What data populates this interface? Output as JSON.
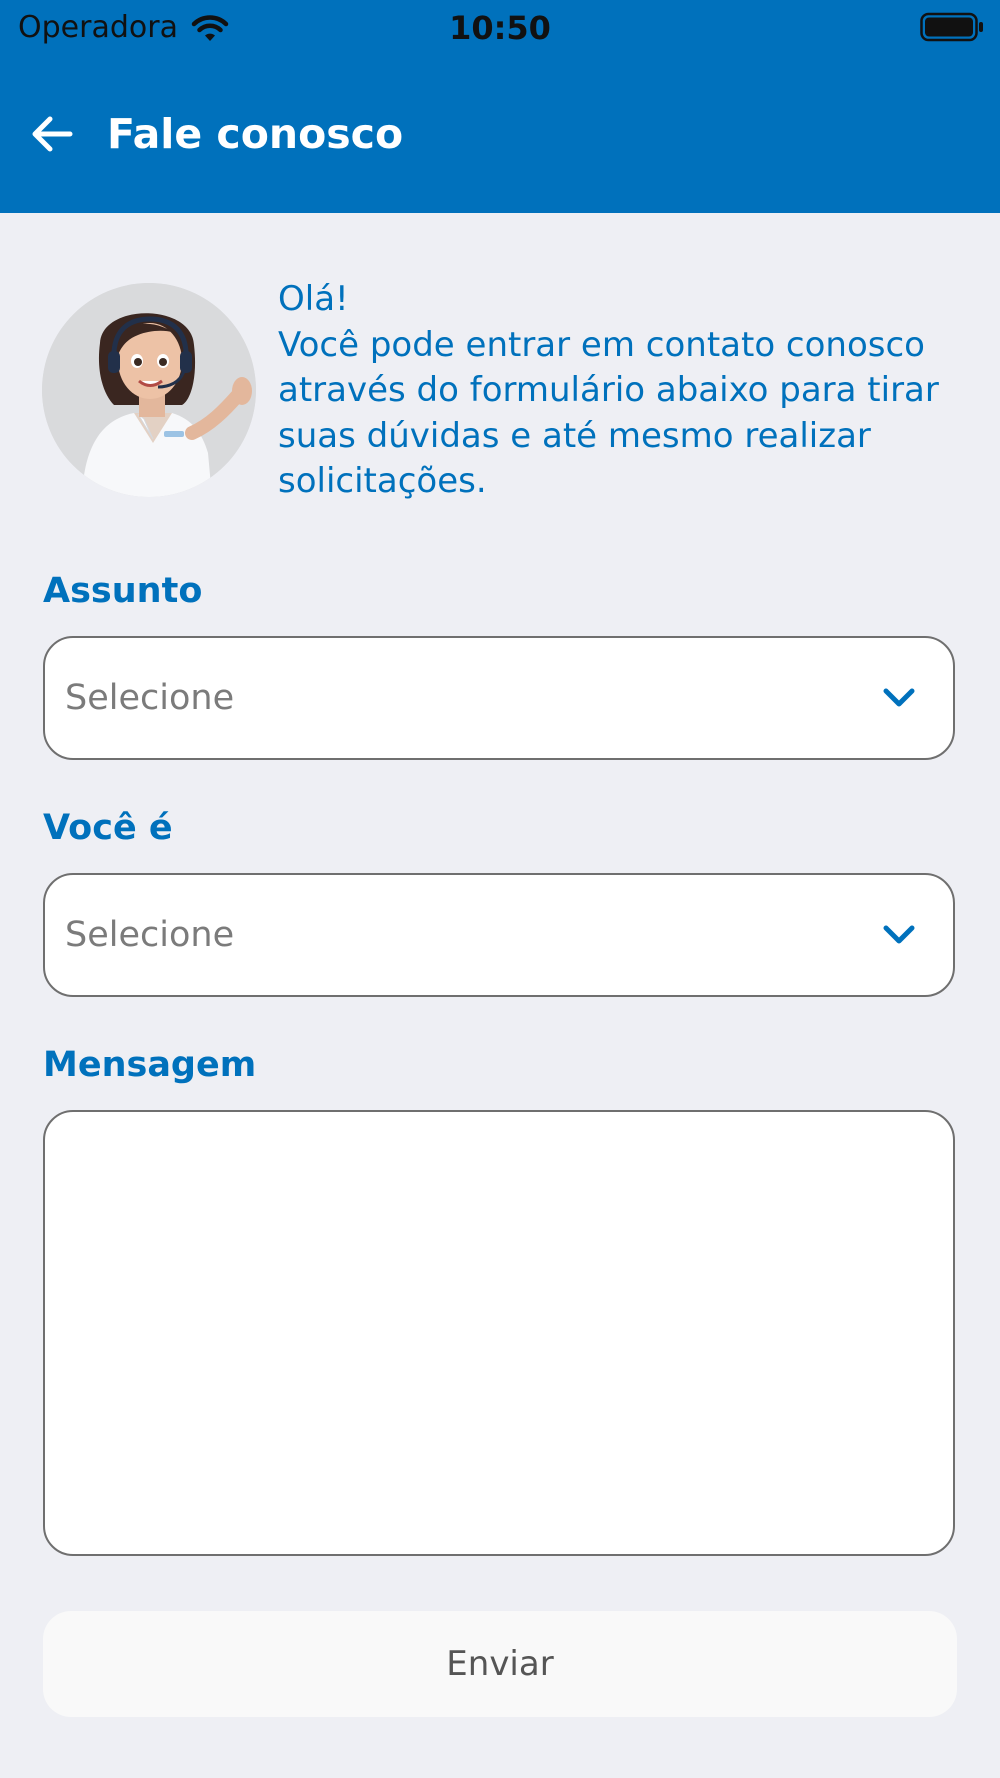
{
  "status_bar": {
    "carrier": "Operadora",
    "time": "10:50"
  },
  "header": {
    "title": "Fale conosco",
    "background": "#0071bc"
  },
  "intro": {
    "lines": [
      "Olá!",
      "Você pode entrar em contato conosco",
      "através do formulário abaixo para tirar",
      "suas dúvidas e até mesmo realizar",
      "solicitações."
    ]
  },
  "form": {
    "assunto": {
      "label": "Assunto",
      "value": "Selecione"
    },
    "voce_e": {
      "label": "Você é",
      "value": "Selecione"
    },
    "mensagem": {
      "label": "Mensagem",
      "value": ""
    },
    "submit_label": "Enviar"
  },
  "colors": {
    "accent": "#0071bc",
    "page_background": "#eeeff4"
  },
  "icons": {
    "back": "arrow-left-icon",
    "select": "chevron-down-icon",
    "wifi": "wifi-icon",
    "battery": "battery-icon"
  }
}
